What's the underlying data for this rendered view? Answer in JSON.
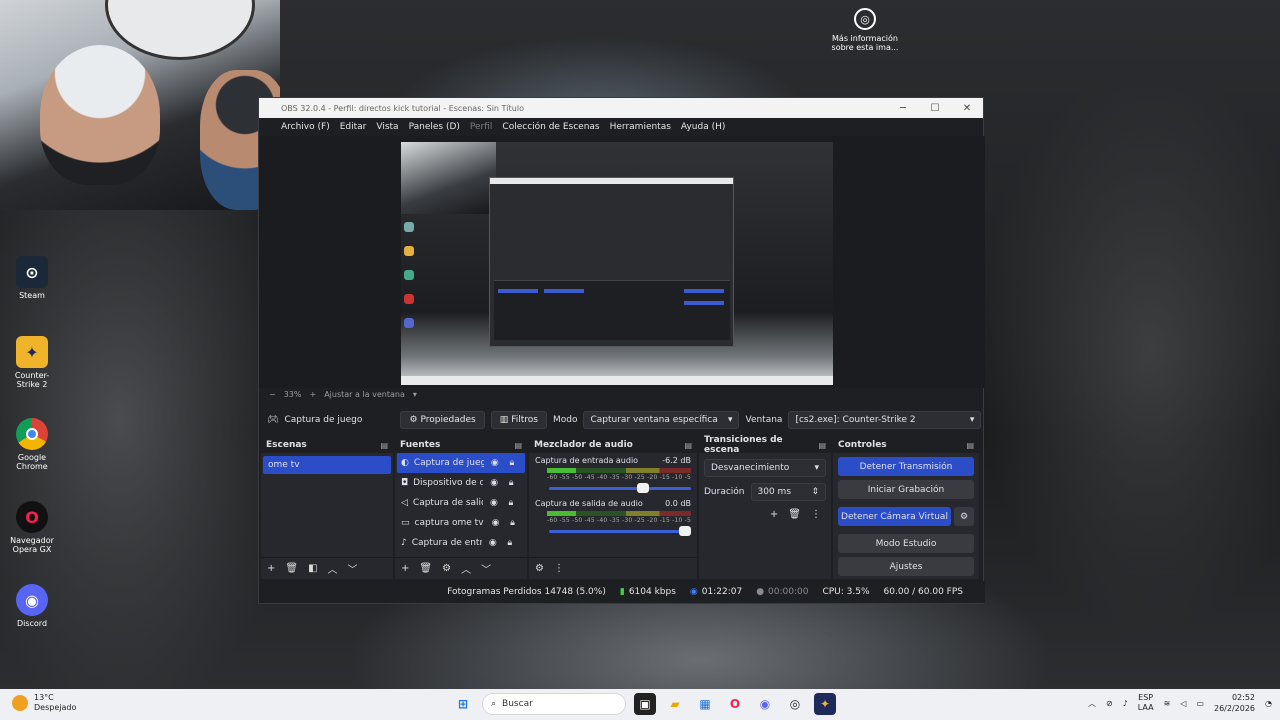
{
  "desktop": {
    "icons": [
      {
        "label": "Steam"
      },
      {
        "label": "Counter-Strike 2"
      },
      {
        "label": "Google Chrome"
      },
      {
        "label": "Navegador Opera GX"
      },
      {
        "label": "Discord"
      }
    ],
    "spotlight_text": "Más información sobre esta ima..."
  },
  "obs": {
    "title": "OBS 32.0.4 - Perfil: directos kick tutorial - Escenas: Sin Título",
    "menu": [
      "Archivo (F)",
      "Editar",
      "Vista",
      "Paneles (D)",
      "Perfil",
      "Colección de Escenas",
      "Herramientas",
      "Ayuda (H)"
    ],
    "zoom_text": "33%",
    "fit_text": "Ajustar a la ventana",
    "source_toolbar": {
      "selected_source": "Captura de juego",
      "properties": "Propiedades",
      "filters": "Filtros",
      "mode_label": "Modo",
      "mode_value": "Capturar ventana específica",
      "window_label": "Ventana",
      "window_value": "[cs2.exe]: Counter-Strike 2"
    },
    "docks": {
      "scenes": {
        "title": "Escenas",
        "items": [
          "ome tv"
        ]
      },
      "sources": {
        "title": "Fuentes",
        "items": [
          "Captura de juego",
          "Dispositivo de captura",
          "Captura de salida",
          "captura ome tv",
          "Captura de entrada"
        ]
      },
      "mixer": {
        "title": "Mezclador de audio",
        "ticks": "-60 -55 -50 -45 -40 -35 -30 -25 -20 -15 -10 -5 0",
        "channels": [
          {
            "name": "Captura de entrada audio",
            "db": "-6.2 dB",
            "level": 0.68
          },
          {
            "name": "Captura de salida de audio",
            "db": "0.0 dB",
            "level": 1.0
          }
        ]
      },
      "transitions": {
        "title": "Transiciones de escena",
        "type": "Desvanecimiento",
        "duration_label": "Duración",
        "duration_value": "300 ms"
      },
      "controls": {
        "title": "Controles",
        "stop_stream": "Detener Transmisión",
        "start_recording": "Iniciar Grabación",
        "stop_virtual_cam": "Detener Cámara Virtual",
        "studio_mode": "Modo Estudio",
        "settings": "Ajustes"
      }
    },
    "status": {
      "dropped": "Fotogramas Perdidos 14748 (5.0%)",
      "bitrate": "6104 kbps",
      "stream_time": "01:22:07",
      "rec_time": "00:00:00",
      "cpu": "CPU: 3.5%",
      "fps": "60.00 / 60.00 FPS"
    }
  },
  "taskbar": {
    "temp": "13°C",
    "weather": "Despejado",
    "search_placeholder": "Buscar",
    "lang": "ESP",
    "lang2": "LAA",
    "time": "02:52",
    "date": "26/2/2026"
  }
}
